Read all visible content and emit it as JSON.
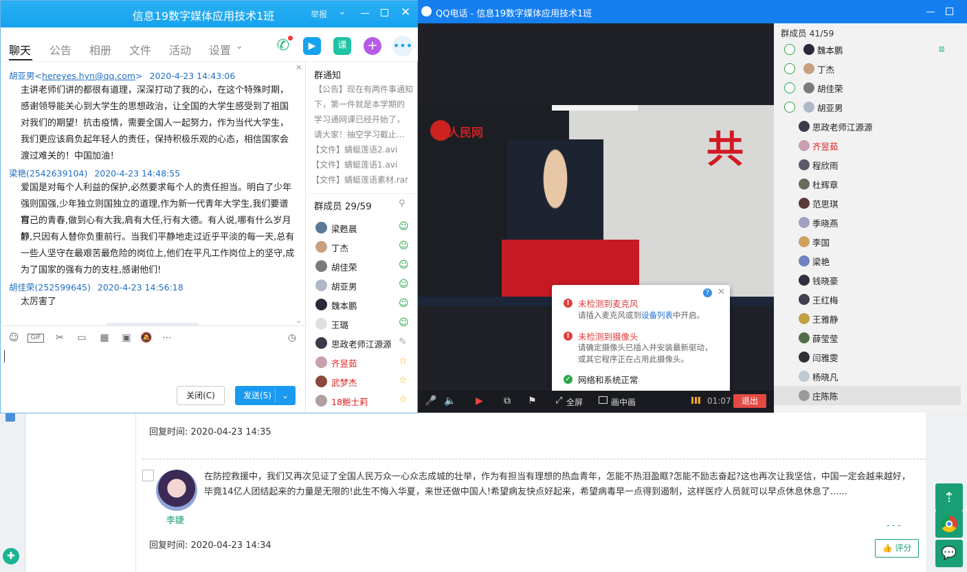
{
  "forum": {
    "reply_time_1": "回复时间: 2020-04-23 14:35",
    "post_text": "在防控救援中，我们又再次见证了全国人民万众一心众志成城的壮举，作为有担当有理想的热血青年，怎能不热泪盈眶?怎能不励志奋起?这也再次让我坚信，中国一定会越来越好，毕竟14亿人团结起来的力量是无限的!此生不悔入华夏，来世还做中国人!希望病友快点好起来，希望病毒早一点得到遏制，这样医疗人员就可以早点休息休息了......",
    "post_author": "李婕",
    "reply_time_2": "回复时间: 2020-04-23 14:34",
    "rate_label": "👍 评分",
    "more_dots": "- - -"
  },
  "chat": {
    "title": "信息19数字媒体应用技术1班",
    "report": "举报",
    "tabs": [
      "聊天",
      "公告",
      "相册",
      "文件",
      "活动",
      "设置"
    ],
    "messages": [
      {
        "name": "胡亚男",
        "contact": "hereyes.hyn@qq.com",
        "time": "2020-4-23 14:43:06",
        "lines": [
          "主讲老师们讲的都很有道理，深深打动了我的心，在这个特殊时期，",
          "感谢领导能关心到大学生的思想政治，让全国的大学生感受到了祖国",
          "对我们的期望！抗击疫情，需要全国人一起努力，作为当代大学生，",
          "我们更应该肩负起年轻人的责任，保持积极乐观的心态，相信国家会",
          "渡过难关的！中国加油！"
        ]
      },
      {
        "name": "梁艳",
        "contact": "2542639104",
        "time": "2020-4-23 14:48:55",
        "lines": [
          "爱国是对每个人利益的保护,必然要求每个人的责任担当。明白了少年",
          "强则国强,少年独立则国独立的道理,作为新一代青年大学生,我们要谱写",
          "自己的青春,做到心有大我,肩有大任,行有大德。有人说,哪有什么岁月静",
          "好,只因有人替你负重前行。当我们平静地走过近乎平淡的每一天,总有",
          "一些人坚守在最艰苦最危险的岗位上,他们在平凡工作岗位上的坚守,成",
          "为了国家的强有力的支柱,感谢他们!"
        ]
      },
      {
        "name": "胡佳荣",
        "contact": "252599645",
        "time": "2020-4-23 14:56:18",
        "lines": [
          "太厉害了"
        ]
      }
    ],
    "close_label": "关闭(C)",
    "send_label": "发送(S)",
    "notice_title": "群通知",
    "notice_lines": [
      "【公告】现在有两件事通知",
      "下，第一件就是本学期的",
      "学习通网课已经开始了，",
      "请大家！抽空学习截止..."
    ],
    "file_lines": [
      "【文件】蜻蜓莲语2.avi",
      "【文件】蜻蜓莲语1.avi",
      "【文件】蜻蜓莲语素材.rar"
    ],
    "members_title": "群成员 29/59",
    "members": [
      {
        "name": "梁甦晨",
        "color": "#5a7a9a",
        "red": false
      },
      {
        "name": "丁杰",
        "color": "#c9a080",
        "red": false
      },
      {
        "name": "胡佳荣",
        "color": "#7a7a7a",
        "red": false
      },
      {
        "name": "胡亚男",
        "color": "#b0b8c8",
        "red": false
      },
      {
        "name": "魏本鹏",
        "color": "#2a2a3a",
        "red": false
      },
      {
        "name": "王璐",
        "color": "#e0e0e0",
        "red": false
      },
      {
        "name": "思政老师江源源",
        "color": "#3a3a4a",
        "red": false
      },
      {
        "name": "齐昱茹",
        "color": "#c8a0b0",
        "red": true
      },
      {
        "name": "武梦杰",
        "color": "#8a4a3a",
        "red": true
      },
      {
        "name": "18鲍士莉",
        "color": "#b0a0a0",
        "red": true
      }
    ]
  },
  "call": {
    "title": "QQ电话 - 信息19数字媒体应用技术1班",
    "members_title": "群成员 41/59",
    "members": [
      {
        "name": "魏本鹏",
        "red": false,
        "host": true
      },
      {
        "name": "丁杰",
        "red": false,
        "host": true
      },
      {
        "name": "胡佳荣",
        "red": false,
        "host": true
      },
      {
        "name": "胡亚男",
        "red": false,
        "host": true
      },
      {
        "name": "思政老师江源源",
        "red": false,
        "host": false
      },
      {
        "name": "齐昱茹",
        "red": true,
        "host": false
      },
      {
        "name": "程欣雨",
        "red": false,
        "host": false
      },
      {
        "name": "杜辉章",
        "red": false,
        "host": false
      },
      {
        "name": "范思琪",
        "red": false,
        "host": false
      },
      {
        "name": "季晓燕",
        "red": false,
        "host": false
      },
      {
        "name": "李国",
        "red": false,
        "host": false
      },
      {
        "name": "梁艳",
        "red": false,
        "host": false
      },
      {
        "name": "钱晓豪",
        "red": false,
        "host": false
      },
      {
        "name": "王红梅",
        "red": false,
        "host": false
      },
      {
        "name": "王雅静",
        "red": false,
        "host": false
      },
      {
        "name": "薛莹莹",
        "red": false,
        "host": false
      },
      {
        "name": "闫雅雯",
        "red": false,
        "host": false
      },
      {
        "name": "杨晓凡",
        "red": false,
        "host": false
      },
      {
        "name": "庄陈陈",
        "red": false,
        "host": false
      }
    ],
    "warn_mic_title": "未检测到麦克风",
    "warn_mic_sub_a": "请插入麦克风或到",
    "warn_mic_link": "设备列表",
    "warn_mic_sub_b": "中开启。",
    "warn_cam_title": "未检测到摄像头",
    "warn_cam_sub_1": "请确定摄像头已插入并安装最新驱动，",
    "warn_cam_sub_2": "或其它程序正在占用此摄像头。",
    "net_ok": "网络和系统正常",
    "fullscreen": "全屏",
    "pip": "画中画",
    "timer": "01:07",
    "exit": "退出",
    "banner_text": "共",
    "logo_text": "人民网"
  }
}
